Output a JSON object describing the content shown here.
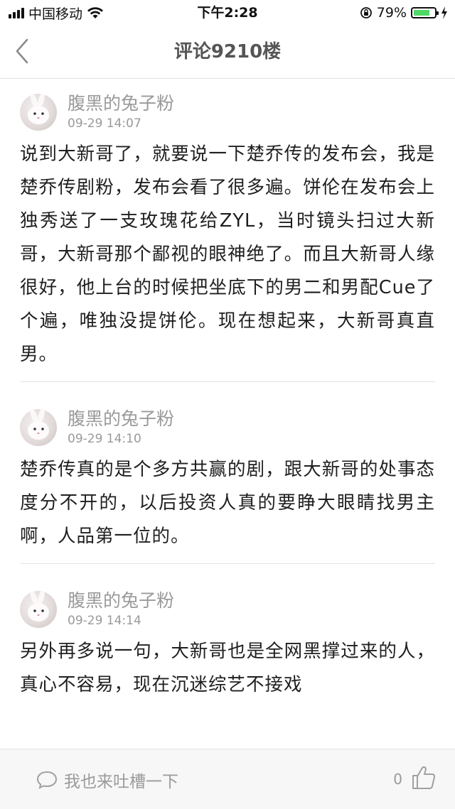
{
  "status": {
    "carrier": "中国移动",
    "time": "下午2:28",
    "battery": "79%",
    "battery_level": 0.79
  },
  "nav": {
    "title": "评论9210楼"
  },
  "comments": [
    {
      "user": "腹黑的兔子粉",
      "time": "09-29 14:07",
      "text": "说到大新哥了，就要说一下楚乔传的发布会，我是楚乔传剧粉，发布会看了很多遍。饼伦在发布会上独秀送了一支玫瑰花给ZYL，当时镜头扫过大新哥，大新哥那个鄙视的眼神绝了。而且大新哥人缘很好，他上台的时候把坐底下的男二和男配Cue了个遍，唯独没提饼伦。现在想起来，大新哥真直男。"
    },
    {
      "user": "腹黑的兔子粉",
      "time": "09-29 14:10",
      "text": "楚乔传真的是个多方共赢的剧，跟大新哥的处事态度分不开的，以后投资人真的要睁大眼睛找男主啊，人品第一位的。"
    },
    {
      "user": "腹黑的兔子粉",
      "time": "09-29 14:14",
      "text": "另外再多说一句，大新哥也是全网黑撑过来的人，真心不容易，现在沉迷综艺不接戏"
    }
  ],
  "bottom": {
    "reply_placeholder": "我也来吐槽一下",
    "like_count": "0"
  }
}
